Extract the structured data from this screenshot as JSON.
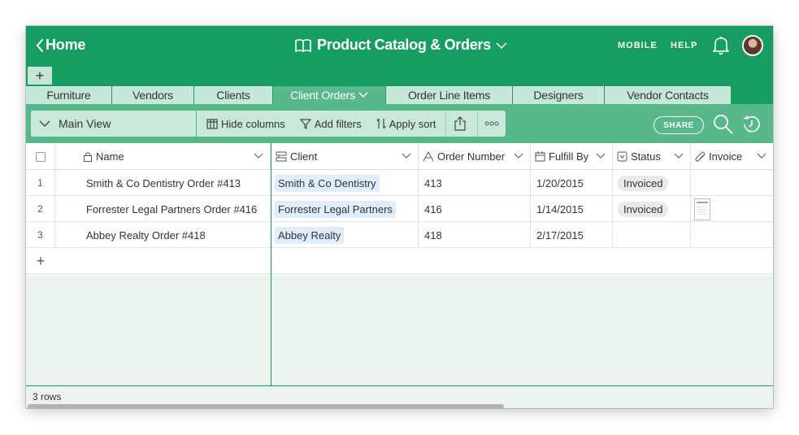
{
  "header": {
    "back_label": "Home",
    "base_title": "Product Catalog & Orders",
    "mobile_label": "MOBILE",
    "help_label": "HELP",
    "icons": [
      "chevron-left-icon",
      "book-icon",
      "chevron-down-icon",
      "bell-icon",
      "avatar"
    ]
  },
  "tabs": {
    "add_label": "+",
    "items": [
      {
        "label": "Furniture",
        "active": false
      },
      {
        "label": "Vendors",
        "active": false
      },
      {
        "label": "Clients",
        "active": false
      },
      {
        "label": "Client Orders",
        "active": true
      },
      {
        "label": "Order Line Items",
        "active": false
      },
      {
        "label": "Designers",
        "active": false
      },
      {
        "label": "Vendor Contacts",
        "active": false
      }
    ]
  },
  "toolbar": {
    "view_name": "Main View",
    "hide_columns": "Hide columns",
    "add_filters": "Add filters",
    "apply_sort": "Apply sort",
    "share_label": "SHARE"
  },
  "grid": {
    "columns": [
      {
        "name": "Name",
        "icon": "lock-icon"
      },
      {
        "name": "Client",
        "icon": "linked-record-icon"
      },
      {
        "name": "Order Number",
        "icon": "text-field-icon"
      },
      {
        "name": "Fulfill By",
        "icon": "calendar-icon"
      },
      {
        "name": "Status",
        "icon": "single-select-icon"
      },
      {
        "name": "Invoice",
        "icon": "paperclip-icon"
      }
    ],
    "rows": [
      {
        "num": "1",
        "name": "Smith & Co Dentistry Order #413",
        "client": "Smith & Co Dentistry",
        "order_number": "413",
        "fulfill_by": "1/20/2015",
        "status": "Invoiced",
        "invoice": false
      },
      {
        "num": "2",
        "name": "Forrester Legal Partners Order #416",
        "client": "Forrester Legal Partners",
        "order_number": "416",
        "fulfill_by": "1/14/2015",
        "status": "Invoiced",
        "invoice": true
      },
      {
        "num": "3",
        "name": "Abbey Realty Order #418",
        "client": "Abbey Realty",
        "order_number": "418",
        "fulfill_by": "2/17/2015",
        "status": "",
        "invoice": false
      }
    ],
    "add_row_label": "+",
    "row_count": "3 rows"
  },
  "colors": {
    "brand": "#179c61",
    "toolbar": "#59b88b",
    "tab_inactive": "#c6e8d7",
    "footer_bg": "#ebf3ee"
  }
}
